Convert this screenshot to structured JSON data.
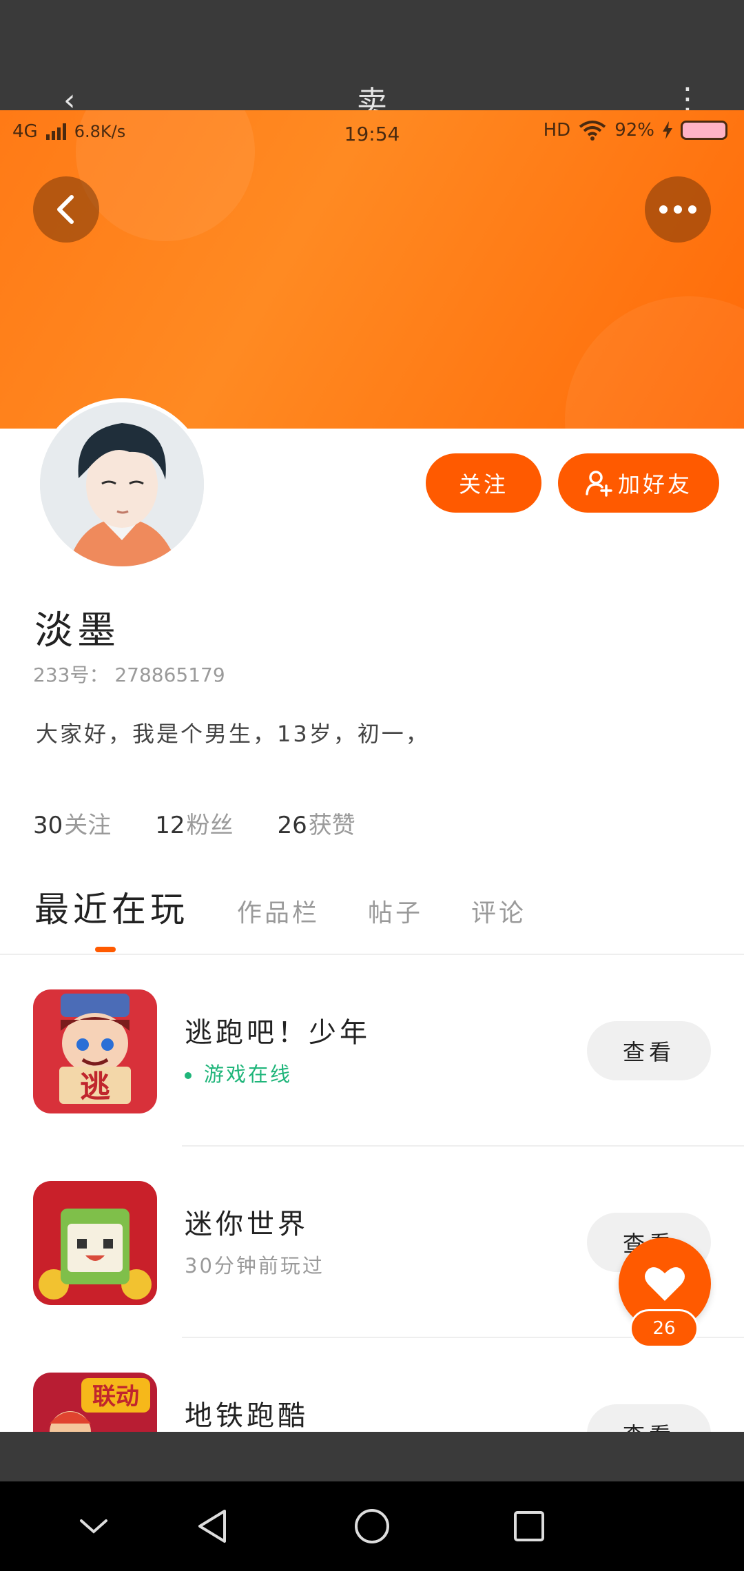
{
  "top_bar": {
    "title": "卖",
    "back_glyph": "‹",
    "menu_glyph": "⋮"
  },
  "status_bar": {
    "network": "4G",
    "speed": "6.8K/s",
    "time": "19:54",
    "hd": "HD",
    "battery": "92%"
  },
  "header": {
    "back_icon": "back-arrow-icon",
    "more_icon": "more-dots-icon"
  },
  "profile": {
    "name": "淡墨",
    "id_line": "233号： 278865179",
    "bio": "大家好，我是个男生，13岁，初一，",
    "follow_label": "关注",
    "add_friend_label": "加好友"
  },
  "stats": [
    {
      "count": "30",
      "label": "关注"
    },
    {
      "count": "12",
      "label": "粉丝"
    },
    {
      "count": "26",
      "label": "获赞"
    }
  ],
  "tabs": [
    {
      "label": "最近在玩",
      "active": true
    },
    {
      "label": "作品栏",
      "active": false
    },
    {
      "label": "帖子",
      "active": false
    },
    {
      "label": "评论",
      "active": false
    }
  ],
  "games": [
    {
      "name": "逃跑吧！少年",
      "status": "游戏在线",
      "online": true,
      "view_label": "查看"
    },
    {
      "name": "迷你世界",
      "status": "30分钟前玩过",
      "online": false,
      "view_label": "查看"
    },
    {
      "name": "地铁跑酷",
      "status": "",
      "online": false,
      "view_label": "查看"
    }
  ],
  "likes": {
    "count": "26"
  },
  "colors": {
    "accent": "#ff5a00",
    "banner": "#ff8a22",
    "online": "#1fb57a"
  }
}
